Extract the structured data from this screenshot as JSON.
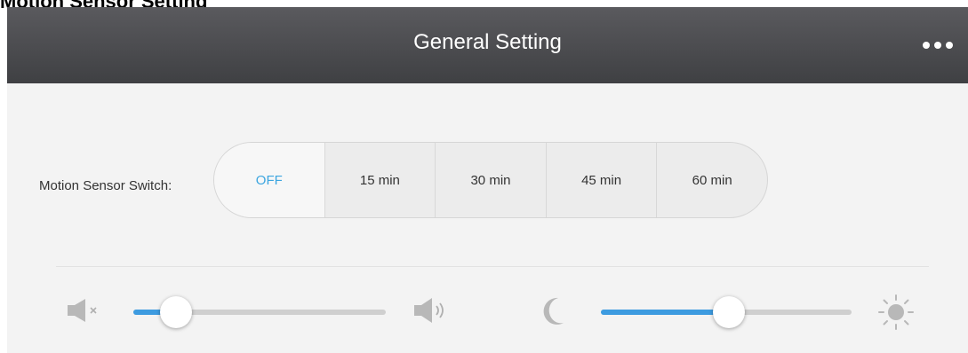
{
  "caption": "Motion Sensor Setting",
  "header": {
    "title": "General Setting",
    "more_icon": "more-dots-icon"
  },
  "motion_sensor": {
    "label": "Motion Sensor Switch:",
    "options": [
      "OFF",
      "15 min",
      "30 min",
      "45 min",
      "60 min"
    ],
    "selected": "OFF"
  },
  "volume": {
    "min_icon": "mute-speaker-icon",
    "max_icon": "speaker-loud-icon",
    "level": 0.17
  },
  "brightness": {
    "min_icon": "moon-icon",
    "max_icon": "sun-icon",
    "level": 0.51
  },
  "colors": {
    "header_bg": "#48494c",
    "accent": "#3d9be0",
    "selected_text": "#3da6e0"
  }
}
